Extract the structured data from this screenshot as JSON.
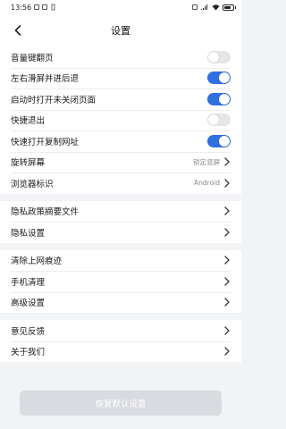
{
  "status_bar": {
    "time": "13:56"
  },
  "header": {
    "title": "设置",
    "back_icon": "chevron-left-icon"
  },
  "groups": [
    {
      "items": [
        {
          "label": "音量键翻页",
          "type": "toggle",
          "on": false
        },
        {
          "label": "左右滑屏并进后退",
          "type": "toggle",
          "on": true
        },
        {
          "label": "启动时打开未关闭页面",
          "type": "toggle",
          "on": true
        },
        {
          "label": "快捷退出",
          "type": "toggle",
          "on": false
        },
        {
          "label": "快速打开复制网址",
          "type": "toggle",
          "on": true
        },
        {
          "label": "旋转屏幕",
          "type": "link",
          "value": "锁定竖屏"
        },
        {
          "label": "浏览器标识",
          "type": "link",
          "value": "Android"
        }
      ]
    },
    {
      "items": [
        {
          "label": "隐私政策摘要文件",
          "type": "link"
        },
        {
          "label": "隐私设置",
          "type": "link"
        }
      ]
    },
    {
      "items": [
        {
          "label": "清除上网痕迹",
          "type": "link"
        },
        {
          "label": "手机清理",
          "type": "link"
        },
        {
          "label": "高级设置",
          "type": "link"
        }
      ]
    },
    {
      "items": [
        {
          "label": "意见反馈",
          "type": "link"
        },
        {
          "label": "关于我们",
          "type": "link"
        }
      ]
    }
  ],
  "reset_button": {
    "label": "恢复默认设置"
  },
  "colors": {
    "accent": "#2f6fe0",
    "toggle_off": "#e6e6e6",
    "background": "#f2f3f5",
    "reset_bg": "#d9dbe0"
  }
}
